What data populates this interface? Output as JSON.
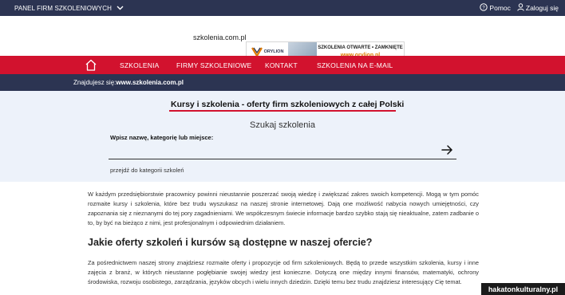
{
  "topbar": {
    "panel_label": "PANEL FIRM SZKOLENIOWYCH",
    "help_label": "Pomoc",
    "login_label": "Zaloguj się"
  },
  "header": {
    "site_name": "szkolenia.com.pl",
    "banner": {
      "logo_text": "ORYLION",
      "line1": "SZKOLENIA OTWARTE • ZAMKNIĘTE",
      "url": "www.orylion.pl"
    }
  },
  "nav": {
    "items": [
      {
        "label": "SZKOLENIA"
      },
      {
        "label": "FIRMY SZKOLENIOWE"
      },
      {
        "label": "KONTAKT"
      },
      {
        "label": "SZKOLENIA NA E-MAIL"
      }
    ]
  },
  "breadcrumb": {
    "prefix": "Znajdujesz się:",
    "current": "www.szkolenia.com.pl"
  },
  "search": {
    "page_title": "Kursy i szkolenia - oferty firm szkoleniowych z całej Polski",
    "heading": "Szukaj szkolenia",
    "label": "Wpisz nazwę, kategorię lub miejsce:",
    "value": "",
    "placeholder": "",
    "category_link": "przejdź do kategorii szkoleń"
  },
  "content": {
    "paragraph1": "W każdym przedsiębiorstwie pracownicy powinni nieustannie poszerzać swoją wiedzę i zwiększać zakres swoich kompetencji. Mogą w tym pomóc rozmaite kursy i szkolenia, które bez trudu wyszukasz na naszej stronie internetowej. Dają one możliwość nabycia nowych umiejętności, czy zapoznania się z nieznanymi do tej pory zagadnieniami. We współczesnym świecie informacje bardzo szybko stają się nieaktualne, zatem zadbanie o to, by być na bieżąco z nimi, jest profesjonalnym i odpowiednim działaniem.",
    "heading2": "Jakie oferty szkoleń i kursów są dostępne w naszej ofercie?",
    "paragraph2": "Za pośrednictwem naszej strony znajdziesz rozmaite oferty i propozycje od firm szkoleniowych. Będą to przede wszystkim szkolenia, kursy i inne zajęcia z branż, w których nieustanne pogłębianie swojej wiedzy jest konieczne. Dotyczą one między innymi finansów, matematyki, ochrony środowiska, rozwoju osobistego, zarządzania, języków obcych i wielu innych dziedzin. Dzięki temu bez trudu znajdziesz interesujący Cię temat."
  },
  "watermark": "hakatonkulturalny.pl",
  "colors": {
    "accent_red": "#d2122e",
    "navy": "#2c3452",
    "panel_bg": "#edf2fa"
  }
}
